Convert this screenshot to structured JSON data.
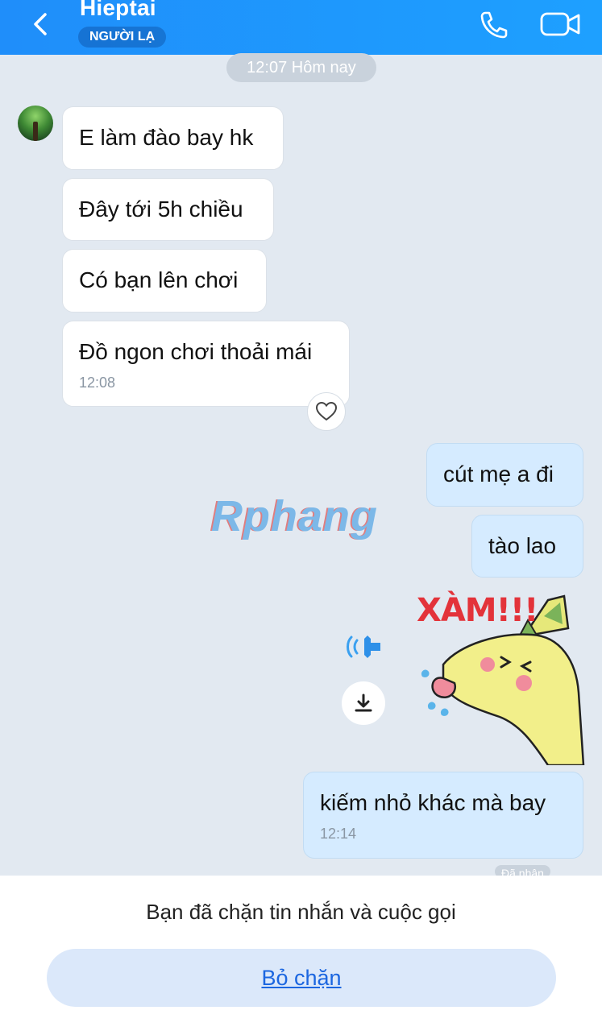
{
  "header": {
    "contact_name": "Hieptai",
    "badge": "NGƯỜI LẠ",
    "icons": [
      "back-arrow-icon",
      "phone-icon",
      "video-call-icon"
    ],
    "background": "#1f8efa"
  },
  "conversation": {
    "time_divider": "12:07 Hôm nay",
    "incoming": [
      {
        "text": "E làm đào bay hk"
      },
      {
        "text": "Đây tới 5h chiều"
      },
      {
        "text": "Có bạn lên chơi"
      },
      {
        "text": "Đồ ngon chơi thoải mái",
        "time": "12:08"
      }
    ],
    "outgoing": [
      {
        "text": "cút mẹ a đi"
      },
      {
        "text": "tào lao"
      },
      {
        "sticker_text": "XÀM!!!"
      },
      {
        "text": "kiếm nhỏ khác mà bay",
        "time": "12:14"
      }
    ],
    "seen_label": "Đã nhận",
    "watermark": "Rphang"
  },
  "footer": {
    "blocked_message": "Bạn đã chặn tin nhắn và cuộc gọi",
    "unblock_label": "Bỏ chặn"
  }
}
